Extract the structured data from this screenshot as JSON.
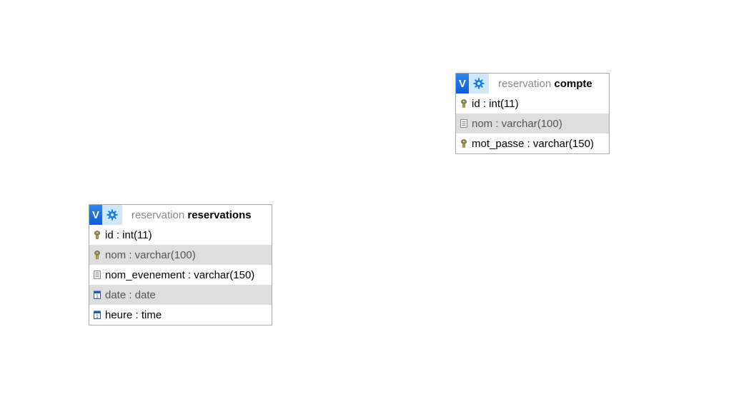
{
  "tables": [
    {
      "database": "reservation",
      "name": "compte",
      "columns": [
        {
          "text": "id : int(11)",
          "icon": "key-icon",
          "shaded": false
        },
        {
          "text": "nom : varchar(100)",
          "icon": "text-field-icon",
          "shaded": true
        },
        {
          "text": "mot_passe : varchar(150)",
          "icon": "key-icon",
          "shaded": false
        }
      ]
    },
    {
      "database": "reservation",
      "name": "reservations",
      "columns": [
        {
          "text": "id : int(11)",
          "icon": "key-icon",
          "shaded": false
        },
        {
          "text": "nom : varchar(100)",
          "icon": "key-icon",
          "shaded": true
        },
        {
          "text": "nom_evenement : varchar(150)",
          "icon": "text-field-icon",
          "shaded": false
        },
        {
          "text": "date : date",
          "icon": "calendar-icon",
          "shaded": true
        },
        {
          "text": "heure : time",
          "icon": "calendar-icon",
          "shaded": false
        }
      ]
    }
  ],
  "header_buttons": {
    "toggle_label": "V",
    "settings_icon": "gear-icon"
  },
  "colors": {
    "toggle_button": "#1a73e8",
    "settings_button": "#cfe6fb",
    "shaded_row": "#dedede",
    "border": "#a9a9a9",
    "database_name": "#8a8a8a"
  }
}
